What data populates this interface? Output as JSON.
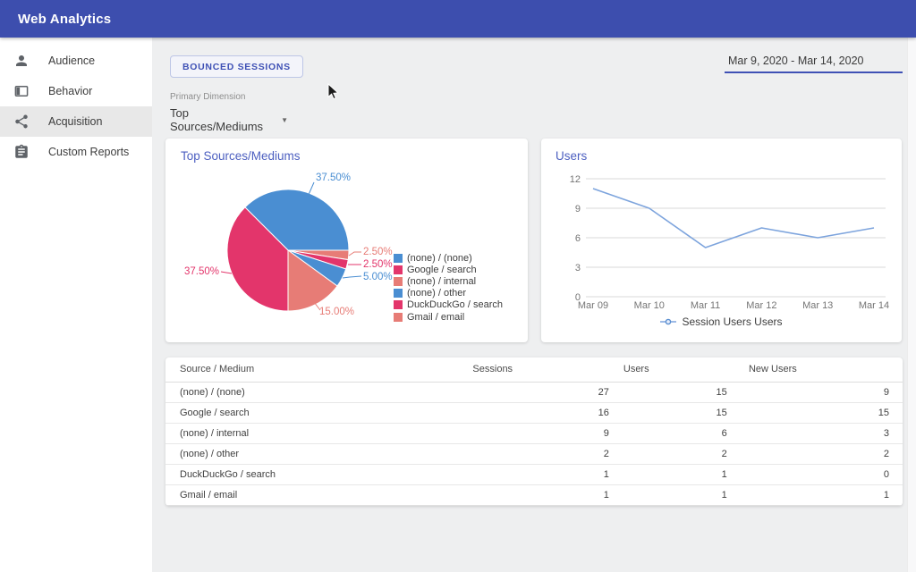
{
  "appbar": {
    "title": "Web Analytics"
  },
  "sidebar": {
    "items": [
      {
        "label": "Audience",
        "icon": "person-icon",
        "active": false
      },
      {
        "label": "Behavior",
        "icon": "window-icon",
        "active": false
      },
      {
        "label": "Acquisition",
        "icon": "share-icon",
        "active": true
      },
      {
        "label": "Custom Reports",
        "icon": "clipboard-icon",
        "active": false
      }
    ]
  },
  "toolbar": {
    "bounced_button": "BOUNCED SESSIONS",
    "date_range": "Mar 9, 2020 - Mar 14, 2020",
    "primary_dimension_label": "Primary Dimension",
    "dimension_value": "Top Sources/Mediums"
  },
  "colors": {
    "appbar": "#3d4eae",
    "accent": "#3f51b5",
    "card_title": "#4c5fc0",
    "pie_blue": "#4a8ed2",
    "pie_crimson": "#e3356b",
    "pie_salmon": "#e77c76",
    "line_blue": "#7da4dd"
  },
  "chart_data": [
    {
      "type": "pie",
      "title": "Top Sources/Mediums",
      "start_angle_deg": -45,
      "slices": [
        {
          "label": "(none) / (none)",
          "value": 37.5,
          "display": "37.50%",
          "color": "#4a8ed2"
        },
        {
          "label": "Gmail / email",
          "value": 2.5,
          "display": "2.50%",
          "color": "#e77c76"
        },
        {
          "label": "DuckDuckGo / search",
          "value": 2.5,
          "display": "2.50%",
          "color": "#e3356b"
        },
        {
          "label": "(none) / other",
          "value": 5.0,
          "display": "5.00%",
          "color": "#4a8ed2"
        },
        {
          "label": "(none) / internal",
          "value": 15.0,
          "display": "15.00%",
          "color": "#e77c76"
        },
        {
          "label": "Google / search",
          "value": 37.5,
          "display": "37.50%",
          "color": "#e3356b"
        }
      ],
      "legend_position": "right",
      "legend": [
        {
          "label": "(none) / (none)",
          "color": "#4a8ed2"
        },
        {
          "label": "Google / search",
          "color": "#e3356b"
        },
        {
          "label": "(none) / internal",
          "color": "#e77c76"
        },
        {
          "label": "(none) / other",
          "color": "#4a8ed2"
        },
        {
          "label": "DuckDuckGo / search",
          "color": "#e3356b"
        },
        {
          "label": "Gmail / email",
          "color": "#e77c76"
        }
      ]
    },
    {
      "type": "line",
      "title": "Users",
      "x": [
        "Mar 09",
        "Mar 10",
        "Mar 11",
        "Mar 12",
        "Mar 13",
        "Mar 14"
      ],
      "values": [
        11,
        9,
        5,
        7,
        6,
        7
      ],
      "yticks": [
        0,
        3,
        6,
        9,
        12
      ],
      "ylim": [
        0,
        12
      ],
      "grid": true,
      "legend": "Session Users Users",
      "line_color": "#7da4dd"
    }
  ],
  "table": {
    "headers": [
      "Source / Medium",
      "Sessions",
      "Users",
      "New Users"
    ],
    "rows": [
      [
        "(none) / (none)",
        27,
        15,
        9
      ],
      [
        "Google / search",
        16,
        15,
        15
      ],
      [
        "(none) / internal",
        9,
        6,
        3
      ],
      [
        "(none) / other",
        2,
        2,
        2
      ],
      [
        "DuckDuckGo / search",
        1,
        1,
        0
      ],
      [
        "Gmail / email",
        1,
        1,
        1
      ]
    ]
  }
}
